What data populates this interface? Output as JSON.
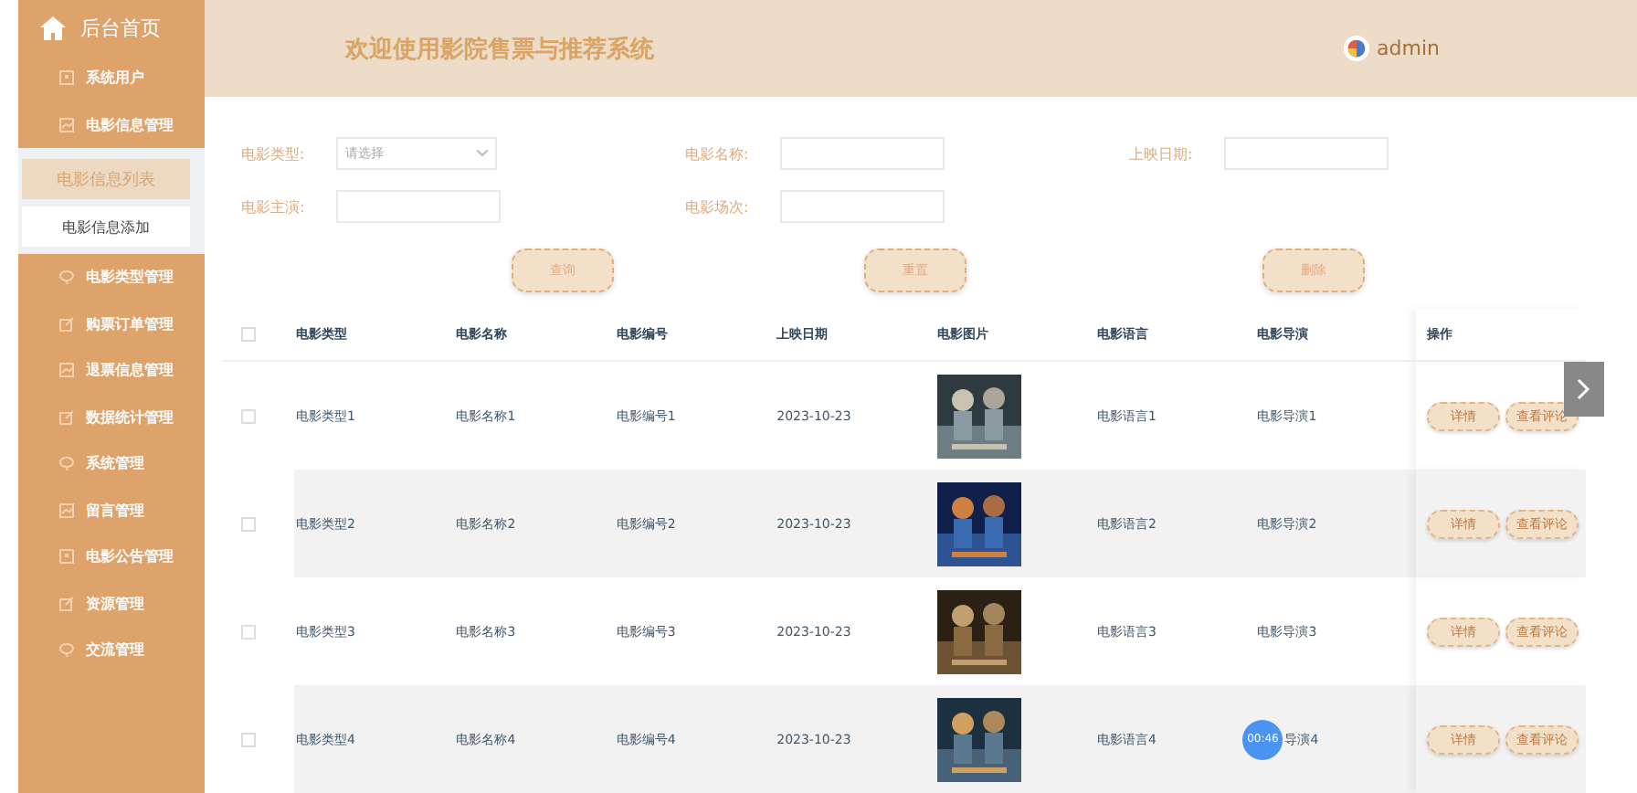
{
  "sidebar": {
    "home": "后台首页",
    "items": [
      {
        "label": "系统用户"
      },
      {
        "label": "电影信息管理",
        "children": [
          {
            "label": "电影信息列表",
            "selected": true
          },
          {
            "label": "电影信息添加",
            "selected": false
          }
        ]
      },
      {
        "label": "电影类型管理"
      },
      {
        "label": "购票订单管理"
      },
      {
        "label": "退票信息管理"
      },
      {
        "label": "数据统计管理"
      },
      {
        "label": "系统管理"
      },
      {
        "label": "留言管理"
      },
      {
        "label": "电影公告管理"
      },
      {
        "label": "资源管理"
      },
      {
        "label": "交流管理"
      }
    ]
  },
  "header": {
    "title": "欢迎使用影院售票与推荐系统",
    "user": "admin"
  },
  "filters": [
    {
      "label": "电影类型:",
      "kind": "select",
      "placeholder": "请选择"
    },
    {
      "label": "电影名称:",
      "kind": "input"
    },
    {
      "label": "上映日期:",
      "kind": "input"
    },
    {
      "label": "电影主演:",
      "kind": "input"
    },
    {
      "label": "电影场次:",
      "kind": "input"
    }
  ],
  "buttons": [
    "查询",
    "重置",
    "删除"
  ],
  "table": {
    "header_checked": false,
    "columns": [
      "电影类型",
      "电影名称",
      "电影编号",
      "上映日期",
      "电影图片",
      "电影语言",
      "电影导演",
      "操作"
    ],
    "rows": [
      {
        "checked": false,
        "cells": [
          "电影类型1",
          "电影名称1",
          "电影编号1",
          "2023-10-23",
          "",
          "电影语言1",
          "电影导演1"
        ],
        "actions": [
          "详情",
          "查看评论"
        ]
      },
      {
        "checked": false,
        "cells": [
          "电影类型2",
          "电影名称2",
          "电影编号2",
          "2023-10-23",
          "",
          "电影语言2",
          "电影导演2"
        ],
        "actions": [
          "详情",
          "查看评论"
        ]
      },
      {
        "checked": false,
        "cells": [
          "电影类型3",
          "电影名称3",
          "电影编号3",
          "2023-10-23",
          "",
          "电影语言3",
          "电影导演3"
        ],
        "actions": [
          "详情",
          "查看评论"
        ]
      },
      {
        "checked": false,
        "cells": [
          "电影类型4",
          "电影名称4",
          "电影编号4",
          "2023-10-23",
          "",
          "电影语言4",
          "导演4"
        ],
        "actions": [
          "详情",
          "查看评论"
        ]
      }
    ]
  },
  "timer": "00:46"
}
